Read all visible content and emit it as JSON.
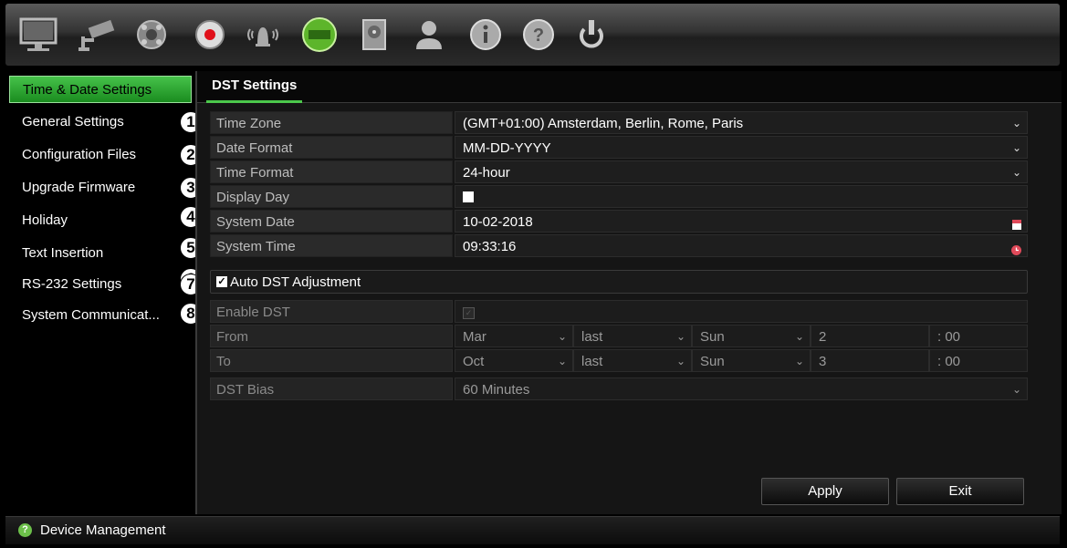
{
  "topbar": {
    "icons": [
      {
        "name": "monitor-icon"
      },
      {
        "name": "camera-icon"
      },
      {
        "name": "network-icon"
      },
      {
        "name": "record-icon"
      },
      {
        "name": "alarm-icon"
      },
      {
        "name": "device-management-icon"
      },
      {
        "name": "storage-icon"
      },
      {
        "name": "user-icon"
      },
      {
        "name": "info-icon"
      },
      {
        "name": "help-icon"
      },
      {
        "name": "power-icon"
      }
    ]
  },
  "sidebar": {
    "items": [
      {
        "label": "Time & Date Settings"
      },
      {
        "label": "General Settings",
        "badge": "1"
      },
      {
        "label": "Configuration Files",
        "badge": "2"
      },
      {
        "label": "Upgrade Firmware",
        "badge": "3"
      },
      {
        "label": "Holiday",
        "badge": "4"
      },
      {
        "label": "Text Insertion",
        "badge": "5"
      },
      {
        "label": "RS-232 Settings",
        "badge": "6"
      },
      {
        "label": "System Communicat...",
        "badge": "7"
      }
    ],
    "extra_badge": "8"
  },
  "tabs": {
    "dst": "DST Settings"
  },
  "form": {
    "time_zone": {
      "label": "Time Zone",
      "value": "(GMT+01:00) Amsterdam, Berlin, Rome, Paris"
    },
    "date_format": {
      "label": "Date Format",
      "value": "MM-DD-YYYY"
    },
    "time_format": {
      "label": "Time Format",
      "value": "24-hour"
    },
    "display_day": {
      "label": "Display Day"
    },
    "system_date": {
      "label": "System Date",
      "value": "10-02-2018"
    },
    "system_time": {
      "label": "System Time",
      "value": "09:33:16"
    },
    "auto_dst": {
      "label": "Auto DST Adjustment",
      "checked": true
    },
    "enable_dst": {
      "label": "Enable DST"
    },
    "from": {
      "label": "From",
      "month": "Mar",
      "week": "last",
      "day": "Sun",
      "hour": "2",
      "minutes": ": 00"
    },
    "to": {
      "label": "To",
      "month": "Oct",
      "week": "last",
      "day": "Sun",
      "hour": "3",
      "minutes": ": 00"
    },
    "dst_bias": {
      "label": "DST Bias",
      "value": "60 Minutes"
    }
  },
  "buttons": {
    "apply": "Apply",
    "exit": "Exit"
  },
  "statusbar": {
    "title": "Device Management"
  },
  "colors": {
    "accent": "#4cc84c",
    "background": "#000000",
    "panel": "#151515"
  }
}
